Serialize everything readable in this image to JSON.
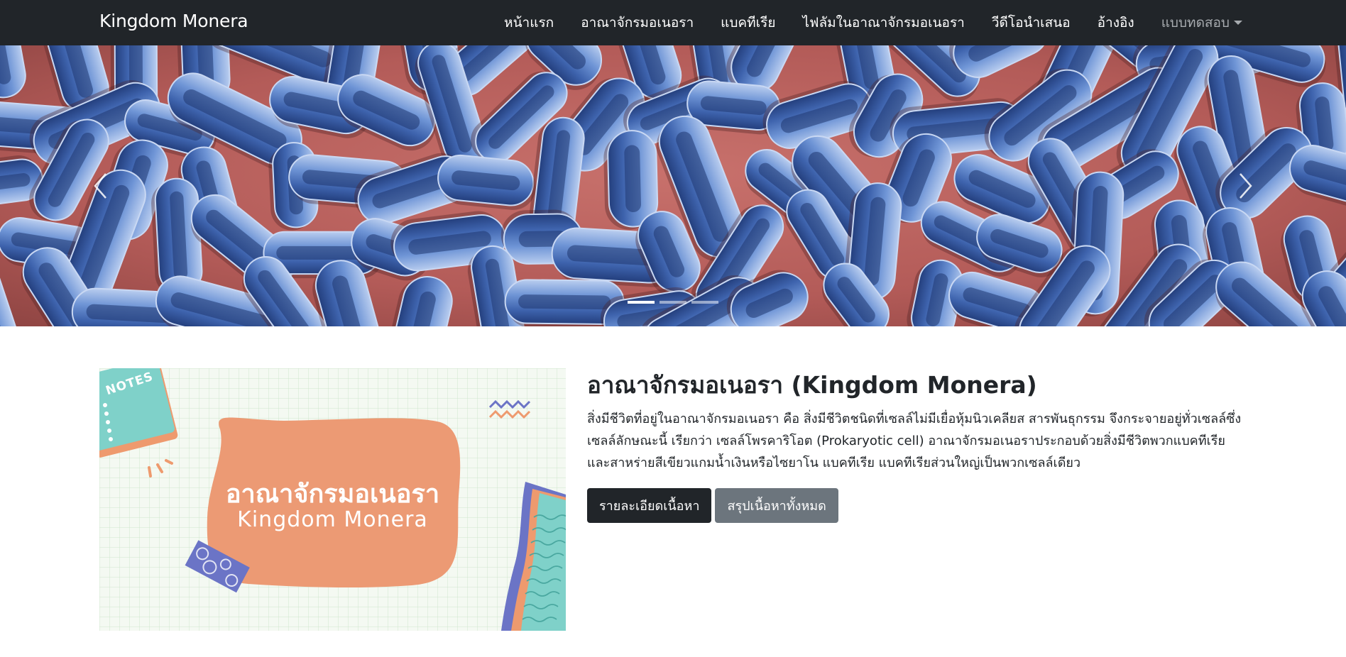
{
  "navbar": {
    "brand": "Kingdom Monera",
    "items": [
      {
        "label": "หน้าแรก"
      },
      {
        "label": "อาณาจักรมอเนอรา"
      },
      {
        "label": "แบคทีเรีย"
      },
      {
        "label": "ไฟลัมในอาณาจักรมอเนอรา"
      },
      {
        "label": "วีดีโอนำเสนอ"
      },
      {
        "label": "อ้างอิง"
      }
    ],
    "dropdown": {
      "label": "แบบทดสอบ",
      "icon": "caret-down-icon"
    }
  },
  "carousel": {
    "slide_count": 3,
    "active_index": 0,
    "prev_icon": "chevron-left-icon",
    "next_icon": "chevron-right-icon"
  },
  "feature": {
    "image_title_th": "อาณาจักรมอเนอรา",
    "image_title_en": "Kingdom Monera",
    "notes_label": "NOTES",
    "headline": "อาณาจักรมอเนอรา (Kingdom Monera)",
    "lead": "สิ่งมีชีวิตที่อยู่ในอาณาจักรมอเนอรา คือ สิ่งมีชีวิตชนิดที่เซลล์ไม่มีเยื่อหุ้มนิวเคลียส สารพันธุกรรม จึงกระจายอยู่ทั่วเซลล์ซึ่งเซลล์ลักษณะนี้ เรียกว่า เซลล์โพรคาริโอต (Prokaryotic cell) อาณาจักรมอเนอราประกอบด้วยสิ่งมีชีวิตพวกแบคทีเรีย และสาหร่ายสีเขียวแกมน้ำเงินหรือไซยาโน แบคทีเรีย แบคทีเรียส่วนใหญ่เป็นพวกเซลล์เดียว",
    "buttons": {
      "detail": "รายละเอียดเนื้อหา",
      "summary": "สรุปเนื้อหาทั้งหมด"
    }
  },
  "colors": {
    "navbar_bg": "#212529",
    "bacteria_blue": "#5b82c6",
    "background_red": "#b4605d",
    "card_orange": "#ec9a74",
    "btn_dark": "#212529",
    "btn_secondary": "#6c757d"
  }
}
